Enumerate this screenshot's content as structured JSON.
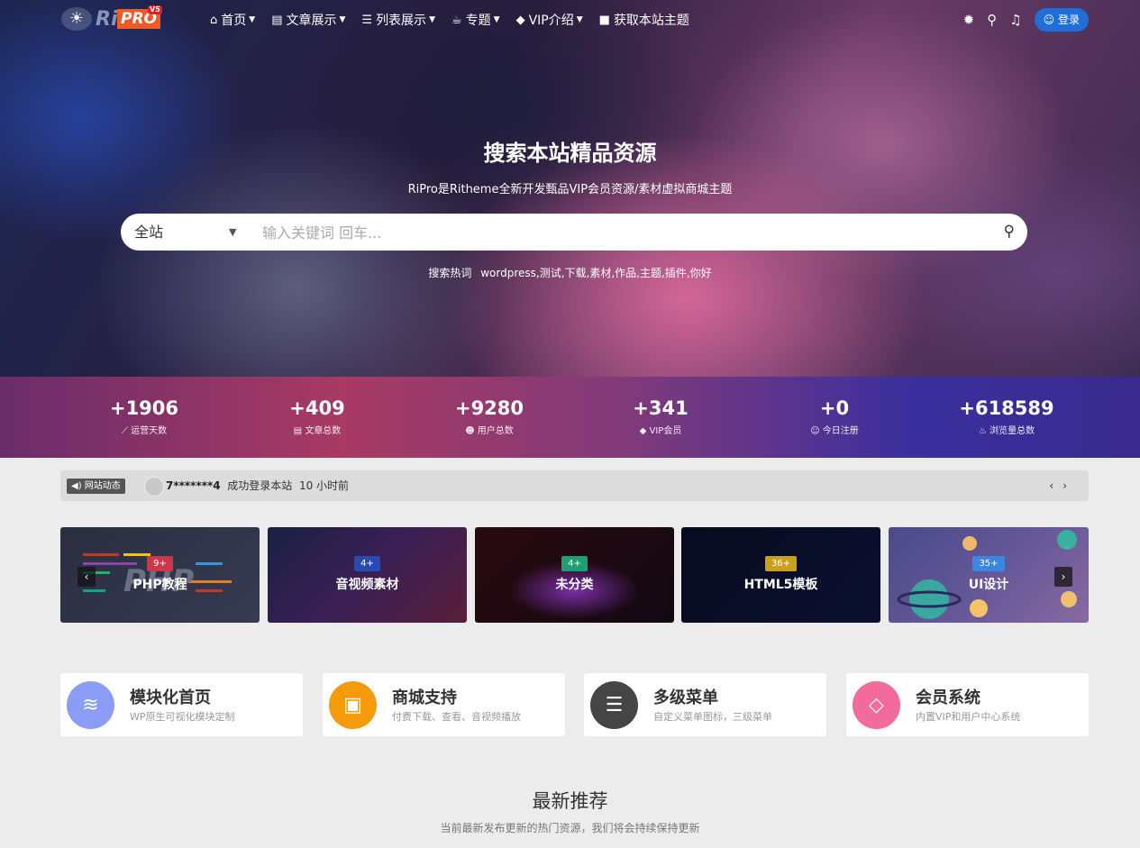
{
  "brand": {
    "logo_ri": "Ri",
    "logo_pro": "PRO",
    "logo_version": "V5"
  },
  "nav": {
    "items": [
      {
        "label": "首页",
        "icon": "home-icon",
        "has_caret": true
      },
      {
        "label": "文章展示",
        "icon": "document-icon",
        "has_caret": true
      },
      {
        "label": "列表展示",
        "icon": "list-icon",
        "has_caret": true
      },
      {
        "label": "专题",
        "icon": "coffee-icon",
        "has_caret": true
      },
      {
        "label": "VIP介绍",
        "icon": "diamond-icon",
        "has_caret": true
      },
      {
        "label": "获取本站主题",
        "icon": "shopping-bag-icon",
        "has_caret": false
      }
    ],
    "login_label": "登录"
  },
  "hero": {
    "title": "搜索本站精品资源",
    "subtitle": "RiPro是Ritheme全新开发甄品VIP会员资源/素材虚拟商城主题",
    "search_scope": "全站",
    "search_placeholder": "输入关键词 回车...",
    "hot_label": "搜索热词",
    "hot_words": "wordpress,测试,下载,素材,作品,主题,插件,你好"
  },
  "stats": [
    {
      "value": "+1906",
      "label": "运营天数",
      "icon": "chart-line-icon"
    },
    {
      "value": "+409",
      "label": "文章总数",
      "icon": "database-icon"
    },
    {
      "value": "+9280",
      "label": "用户总数",
      "icon": "users-icon"
    },
    {
      "value": "+341",
      "label": "VIP会员",
      "icon": "diamond-icon"
    },
    {
      "value": "+0",
      "label": "今日注册",
      "icon": "user-plus-icon"
    },
    {
      "value": "+618589",
      "label": "浏览量总数",
      "icon": "fire-icon"
    }
  ],
  "news": {
    "tag": "网站动态",
    "user": "7*******4",
    "action": "成功登录本站",
    "time": "10 小时前"
  },
  "categories": [
    {
      "name": "PHP教程",
      "count": "9+",
      "badge_color": "#d0364a"
    },
    {
      "name": "音视频素材",
      "count": "4+",
      "badge_color": "#2a4ab3"
    },
    {
      "name": "未分类",
      "count": "4+",
      "badge_color": "#1e9f73"
    },
    {
      "name": "HTML5模板",
      "count": "36+",
      "badge_color": "#c9a11c"
    },
    {
      "name": "UI设计",
      "count": "35+",
      "badge_color": "#3b86e0"
    }
  ],
  "features": [
    {
      "title": "模块化首页",
      "desc": "WP原生可视化模块定制",
      "icon": "layers-icon",
      "color": "#8b9cf7"
    },
    {
      "title": "商城支持",
      "desc": "付费下载、查看、音视频播放",
      "icon": "shopify-bag-icon",
      "color": "#f59a0b"
    },
    {
      "title": "多级菜单",
      "desc": "自定义菜单图标，三级菜单",
      "icon": "menu-lines-icon",
      "color": "#454545"
    },
    {
      "title": "会员系统",
      "desc": "内置VIP和用户中心系统",
      "icon": "diamond-icon",
      "color": "#f26b9a"
    }
  ],
  "section": {
    "title": "最新推荐",
    "subtitle": "当前最新发布更新的热门资源，我们将会持续保持更新"
  }
}
